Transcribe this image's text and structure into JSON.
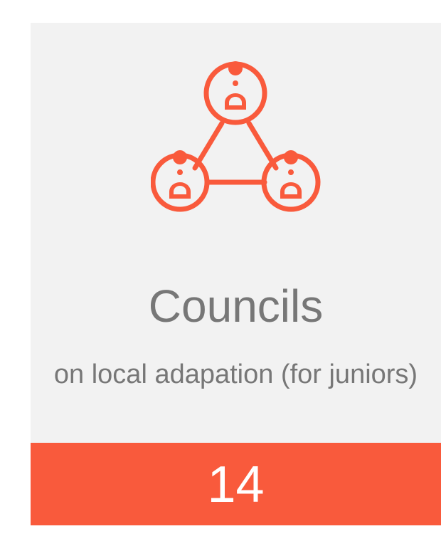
{
  "card": {
    "icon": "people-network-icon",
    "title": "Councils",
    "subtitle": "on local adapation (for juniors)",
    "count": "14"
  },
  "colors": {
    "accent": "#f95a3c",
    "card_background": "#f2f2f2",
    "text": "#777777"
  }
}
